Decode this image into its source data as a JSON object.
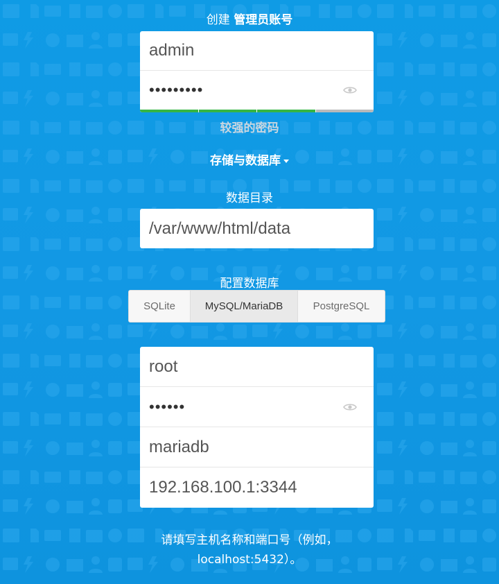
{
  "admin": {
    "heading_prefix": "创建",
    "heading_bold": "管理员账号",
    "username": "admin",
    "password": "•••••••••",
    "strength_label": "较强的密码",
    "strength_level": 0.75
  },
  "storage": {
    "toggle_label": "存储与数据库",
    "data_dir_label": "数据目录",
    "data_dir_value": "/var/www/html/data"
  },
  "database": {
    "configure_label": "配置数据库",
    "options": [
      {
        "label": "SQLite",
        "selected": false
      },
      {
        "label": "MySQL/MariaDB",
        "selected": true
      },
      {
        "label": "PostgreSQL",
        "selected": false
      }
    ],
    "user": "root",
    "password": "••••••",
    "name": "mariadb",
    "host": "192.168.100.1:3344",
    "host_hint_line1": "请填写主机名称和端口号（例如，",
    "host_hint_line2": "localhost:5432）。"
  },
  "colors": {
    "background": "#1298e4",
    "strength_bar": "#36b544",
    "strength_bar_empty": "#b9b9b9",
    "text_on_bg": "#ffffff"
  },
  "icons": {
    "show_password": "eye-icon",
    "toggle": "caret-down-icon"
  }
}
